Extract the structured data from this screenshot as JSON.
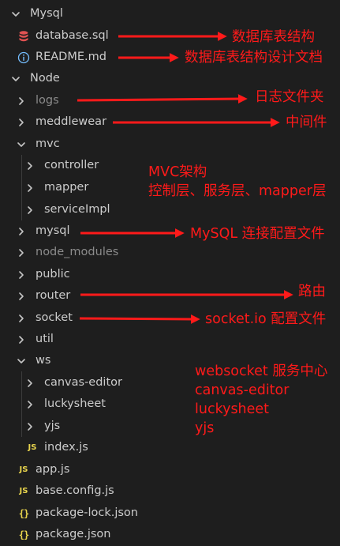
{
  "tree": {
    "mysql_folder": "Mysql",
    "database_sql": "database.sql",
    "readme": "README.md",
    "node_folder": "Node",
    "logs": "logs",
    "meddlewear": "meddlewear",
    "mvc": "mvc",
    "controller": "controller",
    "mapper": "mapper",
    "serviceImpl": "serviceImpl",
    "mysql": "mysql",
    "node_modules": "node_modules",
    "public": "public",
    "router": "router",
    "socket": "socket",
    "util": "util",
    "ws": "ws",
    "canvas_editor": "canvas-editor",
    "luckysheet": "luckysheet",
    "yjs": "yjs",
    "index_js": "index.js",
    "app_js": "app.js",
    "base_config_js": "base.config.js",
    "package_lock_json": "package-lock.json",
    "package_json": "package.json"
  },
  "icons": {
    "js_glyph": "JS",
    "json_glyph": "{}"
  },
  "annotations": {
    "database_sql": "数据库表结构",
    "readme": "数据库表结构设计文档",
    "logs": "日志文件夹",
    "meddlewear": "中间件",
    "mvc_title": "MVC架构",
    "mvc_layers": "控制层、服务层、mapper层",
    "mysql": "MySQL 连接配置文件",
    "router": "路由",
    "socket": "socket.io 配置文件",
    "ws_title": "websocket 服务中心",
    "ws_canvas": "canvas-editor",
    "ws_luckysheet": "luckysheet",
    "ws_yjs": "yjs"
  },
  "colors": {
    "background": "#1e1e1e",
    "text": "#cccccc",
    "dimmed_text": "#8b8b8b",
    "annotation": "#ff1a1a",
    "js_icon": "#e8d44d",
    "json_icon": "#e8d44d",
    "database_icon": "#e05252",
    "info_icon": "#75beff"
  }
}
